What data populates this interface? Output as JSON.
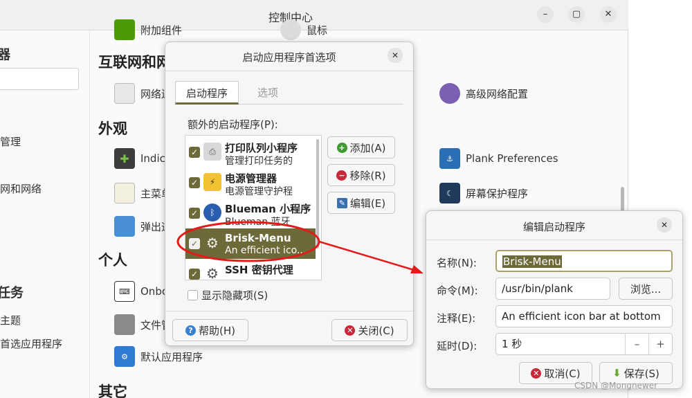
{
  "control_center": {
    "title": "控制中心",
    "window_buttons": [
      "–",
      "▢",
      "✕"
    ],
    "top_partial": [
      "附加组件",
      "鼠标"
    ],
    "sidebar": [
      {
        "text": "器",
        "bold": true
      },
      {
        "text": "管理",
        "bold": false
      },
      {
        "text": "网和网络",
        "bold": false
      },
      {
        "text": "任务",
        "bold": true
      },
      {
        "text": "主题",
        "bold": false
      },
      {
        "text": "首选应用程序",
        "bold": false
      }
    ],
    "sections": {
      "internet": "互联网和网络",
      "appearance": "外观",
      "personal": "个人",
      "other": "其它"
    },
    "items": {
      "network": "网络连接",
      "advanced_network": "高级网络配置",
      "indicators": "Indicators",
      "plank": "Plank Preferences",
      "main_menu": "主菜单",
      "screensaver": "屏幕保护程序",
      "popup": "弹出通知",
      "onboard": "Onboard",
      "files": "文件管理",
      "default_apps": "默认应用程序"
    }
  },
  "startup_dialog": {
    "title": "启动应用程序首选项",
    "tabs": {
      "startup": "启动程序",
      "options": "选项"
    },
    "list_label": "额外的启动程序(P):",
    "items": [
      {
        "name": "打印队列小程序",
        "desc": "管理打印任务的",
        "icon": "printer-icon"
      },
      {
        "name": "电源管理器",
        "desc": "电源管理守护程",
        "icon": "power-icon"
      },
      {
        "name": "Blueman 小程序",
        "desc": "Blueman 蓝牙",
        "icon": "bluetooth-icon"
      },
      {
        "name": "Brisk-Menu",
        "desc": "An efficient ico...",
        "icon": "gears-icon"
      },
      {
        "name": "SSH 密钥代理",
        "desc": "",
        "icon": "gears-icon"
      }
    ],
    "buttons": {
      "add": "添加(A)",
      "remove": "移除(R)",
      "edit": "编辑(E)",
      "help": "帮助(H)",
      "close": "关闭(C)"
    },
    "show_hidden": "显示隐藏项(S)"
  },
  "edit_dialog": {
    "title": "编辑启动程序",
    "labels": {
      "name": "名称(N):",
      "command": "命令(M):",
      "comment": "注释(E):",
      "delay": "延时(D):"
    },
    "values": {
      "name": "Brisk-Menu",
      "command": "/usr/bin/plank",
      "comment": "An efficient icon bar at bottom",
      "delay": "1 秒"
    },
    "buttons": {
      "browse": "浏览...",
      "cancel": "取消(C)",
      "save": "保存(S)",
      "minus": "–",
      "plus": "+"
    }
  },
  "watermark": "CSDN @Mongnewer",
  "colors": {
    "accent": "#6d6a3a",
    "annotation": "#e31a1a"
  }
}
